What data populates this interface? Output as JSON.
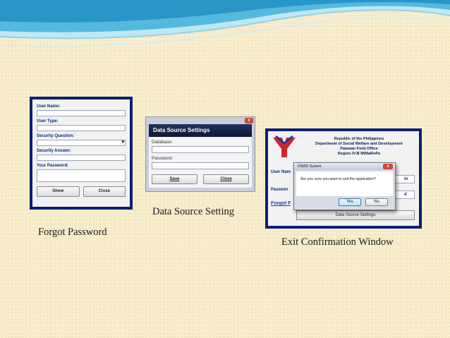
{
  "captions": {
    "forgot_password": "Forgot Password",
    "data_source_setting": "Data Source Setting",
    "exit_confirmation": "Exit Confirmation Window"
  },
  "forgot_password_form": {
    "user_name_label": "User Name:",
    "user_type_label": "User Type:",
    "security_question_label": "Security Question:",
    "security_answer_label": "Security Answer:",
    "your_password_label": "Your Password:",
    "show_button": "Show",
    "close_button": "Close"
  },
  "data_source_form": {
    "title": "Data Source Settings",
    "database_label": "Database:",
    "password_label": "Password:",
    "save_button": "Save",
    "close_button": "Close",
    "close_glyph": "x"
  },
  "exit_window": {
    "header_line1": "Republic of the Philippines",
    "header_line2": "Department of Social Welfare and Development",
    "header_line3": "Palawan Field Office",
    "header_line4": "Region IV-B MiMaRoPa",
    "user_name_label": "User Nam",
    "password_label": "Passwor",
    "field_partial_1": "in",
    "field_partial_2": "d",
    "forgot_link": "Forgot F",
    "data_source_button": "Data Source Settings",
    "dialog": {
      "title": "DSWD System",
      "message": "Are you sure you want to exit the application?",
      "yes_button": "Yes",
      "no_button": "No",
      "close_glyph": "x"
    }
  },
  "colors": {
    "background": "#f8eccb",
    "wave_blue": "#55b9de",
    "panel_frame": "#0c1f70",
    "title_bar": "#0c1733"
  }
}
